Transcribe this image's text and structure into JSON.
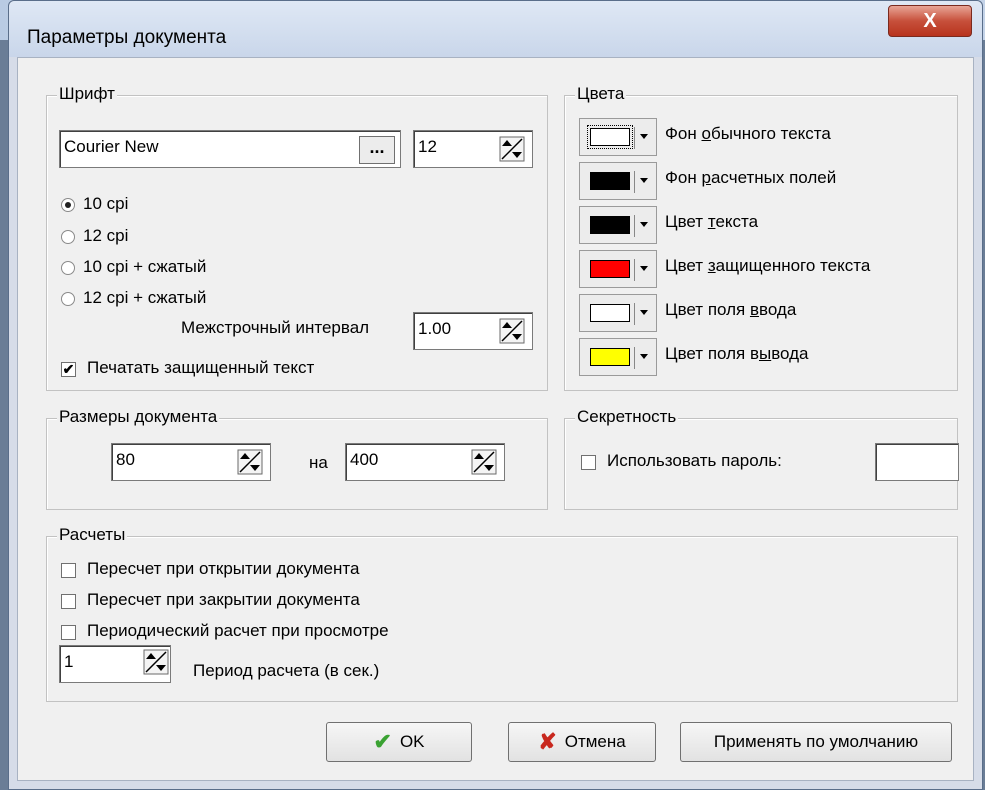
{
  "window": {
    "title": "Параметры документа",
    "close_glyph": "X"
  },
  "font_group": {
    "label": "Шрифт",
    "font_name": "Courier New",
    "browse_label": "...",
    "font_size": "12",
    "radios": [
      {
        "label": "10 cpi",
        "checked": true
      },
      {
        "label": "12 cpi",
        "checked": false
      },
      {
        "label": "10 cpi + сжатый",
        "checked": false
      },
      {
        "label": "12 cpi + сжатый",
        "checked": false
      }
    ],
    "line_spacing_label": "Межстрочный интервал",
    "line_spacing_value": "1.00",
    "print_protected_label": "Печатать защищенный текст",
    "print_protected_checked": true
  },
  "colors_group": {
    "label": "Цвета",
    "items": [
      {
        "label_pre": "Фон ",
        "label_u": "о",
        "label_post": "бычного текста",
        "color": "#ffffff"
      },
      {
        "label_pre": "Фон ",
        "label_u": "р",
        "label_post": "асчетных полей",
        "color": "#000000"
      },
      {
        "label_pre": "Цвет ",
        "label_u": "т",
        "label_post": "екста",
        "color": "#000000"
      },
      {
        "label_pre": "Цвет ",
        "label_u": "з",
        "label_post": "ащищенного текста",
        "color": "#ff0000"
      },
      {
        "label_pre": "Цвет поля ",
        "label_u": "в",
        "label_post": "вода",
        "color": "#ffffff"
      },
      {
        "label_pre": "Цвет поля в",
        "label_u": "ы",
        "label_post": "вода",
        "color": "#ffff00"
      }
    ]
  },
  "size_group": {
    "label": "Размеры документа",
    "width": "80",
    "by_label": "на",
    "height": "400"
  },
  "secret_group": {
    "label": "Секретность",
    "use_password_label": "Использовать пароль:",
    "use_password_checked": false,
    "password": ""
  },
  "calc_group": {
    "label": "Расчеты",
    "checks": [
      {
        "label": "Пересчет при открытии документа",
        "checked": false
      },
      {
        "label": "Пересчет при закрытии документа",
        "checked": false
      },
      {
        "label": "Периодический расчет при просмотре",
        "checked": false
      }
    ],
    "period_value": "1",
    "period_label": "Период расчета (в сек.)"
  },
  "buttons": {
    "ok": "OK",
    "cancel": "Отмена",
    "default": "Применять по умолчанию"
  },
  "accent_colors": {
    "ok_icon": "#3aa232",
    "cancel_icon": "#c8281e"
  }
}
